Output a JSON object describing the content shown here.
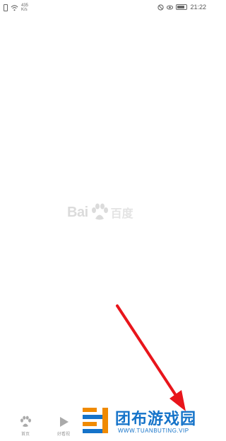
{
  "status_bar": {
    "net_speed_value": "435",
    "net_speed_unit": "K/s",
    "time": "21:22"
  },
  "splash": {
    "logo_text": "Bai",
    "logo_cn": "百度"
  },
  "bottom_nav": {
    "items": [
      {
        "label": "首页",
        "icon": "paw-icon"
      },
      {
        "label": "好看视",
        "icon": "play-icon"
      }
    ]
  },
  "watermark": {
    "title": "团布游戏园",
    "url": "WWW.TUANBUTING.VIP"
  },
  "colors": {
    "arrow": "#e8151b",
    "watermark_blue": "#1573c9",
    "watermark_orange": "#f08a00"
  }
}
